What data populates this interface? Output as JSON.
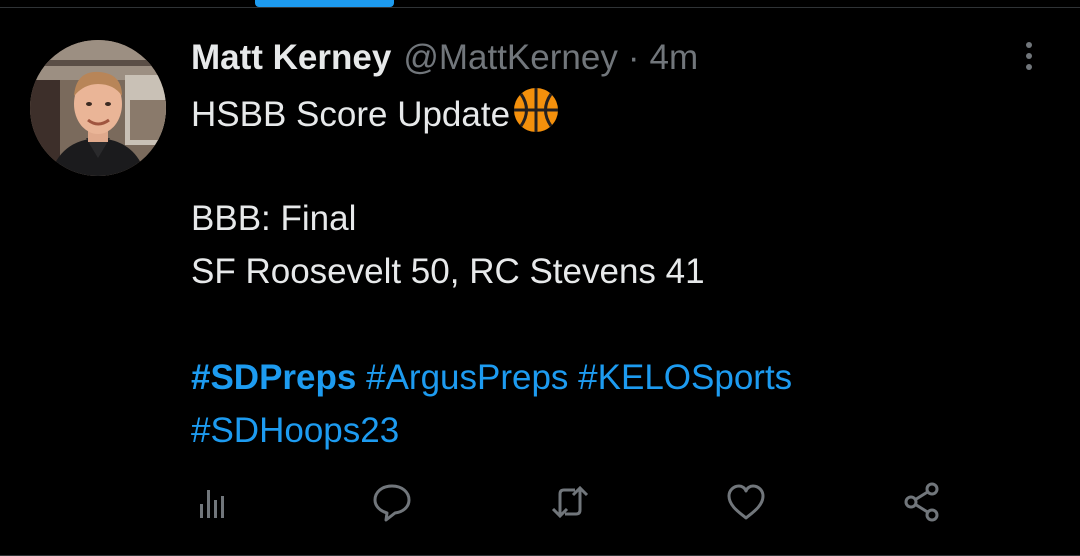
{
  "tweet": {
    "display_name": "Matt Kerney",
    "handle": "@MattKerney",
    "separator": "·",
    "time": "4m",
    "lines": {
      "headline": "HSBB Score Update",
      "status": "BBB: Final",
      "score": "SF Roosevelt 50, RC Stevens 41"
    },
    "hashtags": {
      "tag1": "#SDPreps",
      "tag2": "#ArgusPreps",
      "tag3": "#KELOSports",
      "tag4": "#SDHoops23"
    },
    "emoji": "basketball-emoji"
  },
  "actions": {
    "analytics": "analytics-icon",
    "reply": "reply-icon",
    "retweet": "retweet-icon",
    "like": "like-icon",
    "share": "share-icon"
  },
  "colors": {
    "background": "#000000",
    "text": "#e7e9ea",
    "secondary": "#71767b",
    "accent": "#1d9bf0",
    "basketball": "#f4900c"
  }
}
